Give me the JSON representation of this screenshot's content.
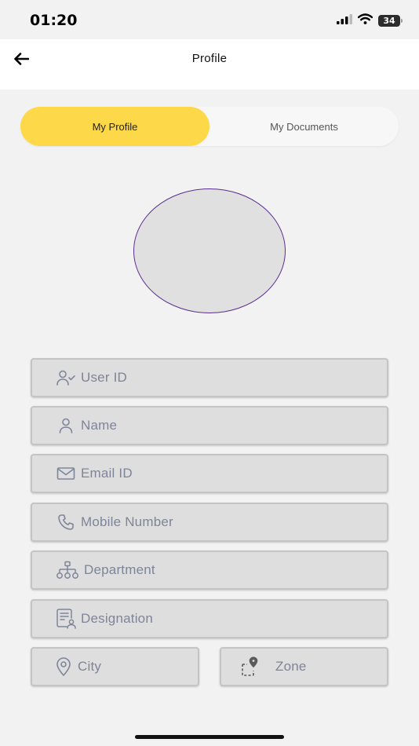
{
  "status_bar": {
    "time": "01:20",
    "battery": "34"
  },
  "header": {
    "title": "Profile"
  },
  "tabs": [
    {
      "label": "My Profile",
      "active": true
    },
    {
      "label": "My Documents",
      "active": false
    }
  ],
  "form": {
    "user_id": {
      "placeholder": "User ID",
      "icon": "user-check-icon"
    },
    "name": {
      "placeholder": "Name",
      "icon": "user-icon"
    },
    "email": {
      "placeholder": "Email ID",
      "icon": "mail-icon"
    },
    "mobile": {
      "placeholder": "Mobile Number",
      "icon": "phone-icon"
    },
    "department": {
      "placeholder": "Department",
      "icon": "hierarchy-icon"
    },
    "designation": {
      "placeholder": "Designation",
      "icon": "id-card-icon"
    },
    "city": {
      "placeholder": "City",
      "icon": "location-pin-icon"
    },
    "zone": {
      "placeholder": "Zone",
      "icon": "zone-pin-icon"
    }
  },
  "colors": {
    "accent": "#fdd94a",
    "avatar_border": "#5a2d91",
    "placeholder_text": "#7d8599",
    "field_bg": "#dedede"
  }
}
